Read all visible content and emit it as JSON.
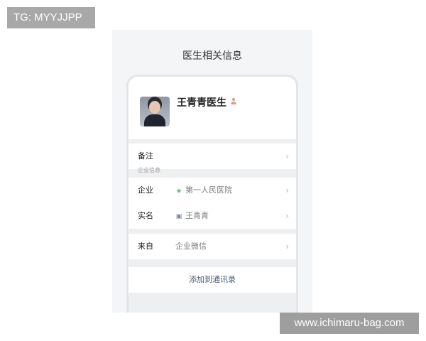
{
  "watermarks": {
    "top_left": "TG: MYYJJPP",
    "bottom_right": "www.ichimaru-bag.com"
  },
  "page": {
    "title": "医生相关信息"
  },
  "profile": {
    "name": "王青青医生",
    "avatar_icon": "doctor-avatar",
    "badge_icon": "person-icon"
  },
  "rows": {
    "remark": {
      "label": "备注"
    },
    "section_label": "企业信息",
    "company": {
      "label": "企业",
      "value": "第一人民医院",
      "icon": "shield-check-icon"
    },
    "realname": {
      "label": "实名",
      "value": "王青青",
      "icon": "id-card-icon"
    },
    "source": {
      "label": "来自",
      "value": "企业微信"
    }
  },
  "action": {
    "label": "添加到通讯录"
  },
  "colors": {
    "accent": "#4b5a7a",
    "verified": "#58b07a"
  }
}
